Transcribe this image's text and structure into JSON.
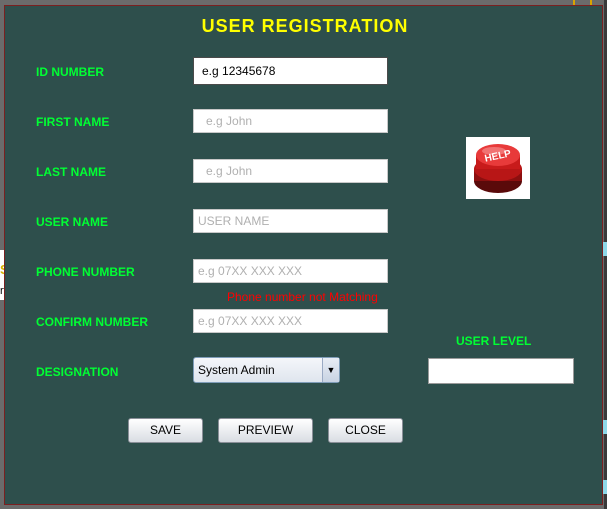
{
  "dialog": {
    "title": "USER REGISTRATION",
    "fields": {
      "id_number": {
        "label": "ID NUMBER",
        "value": "e.g 12345678"
      },
      "first_name": {
        "label": "FIRST NAME",
        "placeholder": "e.g John"
      },
      "last_name": {
        "label": "LAST NAME",
        "placeholder": "e.g John"
      },
      "user_name": {
        "label": "USER NAME",
        "placeholder": "USER NAME"
      },
      "phone_number": {
        "label": "PHONE NUMBER",
        "placeholder": "e.g 07XX XXX XXX"
      },
      "confirm_number": {
        "label": "CONFIRM NUMBER",
        "placeholder": "e.g 07XX XXX XXX"
      },
      "designation": {
        "label": "DESIGNATION",
        "selected": "System Admin"
      }
    },
    "phone_error": "Phone number not Matching",
    "user_level": {
      "label": "USER LEVEL",
      "value": ""
    },
    "help_icon": {
      "text": "HELP",
      "icon": "red-help-button"
    },
    "buttons": {
      "save": "SAVE",
      "preview": "PREVIEW",
      "close": "CLOSE"
    }
  },
  "background": {
    "fragment_letter": "S",
    "fragment_text": "ry"
  },
  "colors": {
    "dialog_bg": "#2e4f4c",
    "title": "#ffff00",
    "label": "#00ff33",
    "error": "#ff0000"
  }
}
